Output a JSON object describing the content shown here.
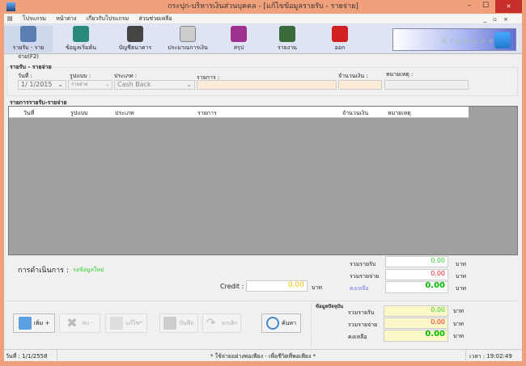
{
  "window": {
    "title": "กระปุก-บริหารเงินส่วนบุคคล - [แก้ไขข้อมูลรายรับ - รายจ่าย]",
    "min": "–",
    "max": "☐",
    "close": "✕"
  },
  "menu": [
    "โปรแกรม",
    "หน้าต่าง",
    "เกี่ยวกับโปรแกรม",
    "ส่วนช่วยเหลือ"
  ],
  "toolbar": [
    {
      "label": "รายรับ - รายจ่าย(F2)",
      "icon": "cabinet-icon",
      "color": "#5a7fb0"
    },
    {
      "label": "ข้อมูลเริ่มต้น",
      "icon": "monitor-icon",
      "color": "#2a8a7a"
    },
    {
      "label": "บัญชีธนาคาร",
      "icon": "book-icon",
      "color": "#444"
    },
    {
      "label": "ประมาณการเงิน",
      "icon": "calendar-icon",
      "color": "#ccc"
    },
    {
      "label": "สรุป",
      "icon": "cube-icon",
      "color": "#a03090"
    },
    {
      "label": "รายงาน",
      "icon": "chart-icon",
      "color": "#3a6a3a"
    },
    {
      "label": "ออก",
      "icon": "power-icon",
      "color": "#d02020"
    }
  ],
  "logo": "Krapook",
  "form": {
    "group": "รายรับ - รายจ่าย",
    "date_label": "วันที่ :",
    "type_label": "รูปแบบ :",
    "category_label": "ประเภท :",
    "item_label": "รายการ :",
    "amount_label": "จำนวนเงิน :",
    "note_label": "หมายเหตุ :",
    "date": "1/ 1/2015",
    "type": "รายจ่าย",
    "category": "Cash Back",
    "item": "",
    "amount": "",
    "note": ""
  },
  "grid": {
    "title": "รายการรายรับ-รายจ่าย",
    "columns": [
      "วันที่",
      "รูปแบบ",
      "ประเภท",
      "รายการ",
      "จำนวนเงิน",
      "หมายเหตุ"
    ]
  },
  "status": {
    "label": "การดำเนินการ :",
    "value": "รอข้อมูลใหม่"
  },
  "totals": {
    "income_label": "รวมรายรับ",
    "expense_label": "รวมรายจ่าย",
    "balance_label": "คงเหลือ",
    "income": "0.00",
    "expense": "0.00",
    "balance": "0.00",
    "unit": "บาท",
    "credit_label": "Credit :",
    "credit": "0.00"
  },
  "buttons": {
    "add": "เพิ่ม +",
    "delete": "ลบ -",
    "edit": "แก้ไข*",
    "save": "บันทึก",
    "cancel": "ยกเลิก",
    "search": "ค้นหา"
  },
  "current": {
    "title": "ข้อมูลปัจจุบัน",
    "income_label": "รวมรายรับ",
    "expense_label": "รวมรายจ่าย",
    "balance_label": "คงเหลือ",
    "income": "0.00",
    "expense": "0.00",
    "balance": "0.00",
    "unit": "บาท"
  },
  "statusbar": {
    "date": "วันที่ : 1/1/2558",
    "motto": "* ใช้จ่ายอย่างพอเพียง - เพื่อชีวิตที่พอเพียง *",
    "time": "เวลา : 19:02:49"
  },
  "colors": {
    "income": "#33cc33",
    "expense": "#ee2222",
    "balance": "#00bb00",
    "credit": "#f0c000",
    "accent": "#f0a07a"
  }
}
